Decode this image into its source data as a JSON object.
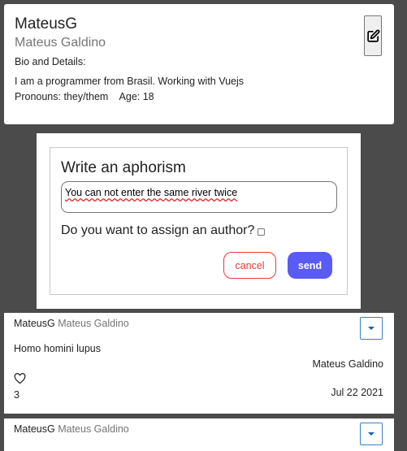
{
  "profile": {
    "username": "MateusG",
    "full_name": "Mateus Galdino",
    "bio_heading": "Bio and Details:",
    "bio": "I am a programmer from Brasil. Working with Vuejs",
    "pronouns_line": "Pronouns: they/them    Age: 18"
  },
  "aphorism_form": {
    "title": "Write an aphorism",
    "input_value": "You can not enter the same river twice",
    "author_question": "Do you want to assign an author?",
    "cancel_label": "cancel",
    "send_label": "send"
  },
  "posts": [
    {
      "username": "MateusG",
      "full_name": "Mateus Galdino",
      "text": "Homo homini lupus",
      "author": "Mateus Galdino",
      "likes": "3",
      "date": "Jul 22 2021",
      "like_icon": "heart-icon",
      "menu_icon": "caret-down-icon"
    },
    {
      "username": "MateusG",
      "full_name": "Mateus Galdino",
      "menu_icon": "caret-down-icon"
    }
  ],
  "colors": {
    "page_background": "#4b4b4b",
    "cancel": "#e23b3b",
    "send": "#5a5af5",
    "dropdown_border": "#3d7fc7",
    "secondary_text": "#757575"
  }
}
